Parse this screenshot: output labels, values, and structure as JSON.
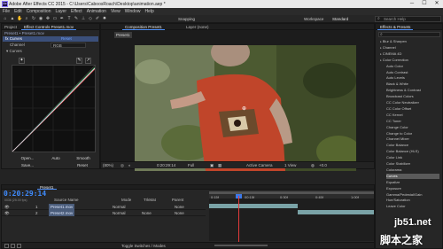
{
  "window": {
    "title": "Adobe After Effects CC 2015 - C:\\Users\\CaboosRoach\\Desktop\\animation.aep *",
    "logo": "Ae",
    "minimize": "─",
    "maximize": "☐",
    "close": "✕"
  },
  "menu": [
    "File",
    "Edit",
    "Composition",
    "Layer",
    "Effect",
    "Animation",
    "View",
    "Window",
    "Help"
  ],
  "toolbar": {
    "snapping": "Snapping",
    "workspace_label": "Workspace",
    "workspace_value": "Standard",
    "search_placeholder": "Search Help"
  },
  "effect_controls": {
    "tab_project": "Project",
    "tab_label": "Effect Controls  Preset1.mov",
    "breadcrumb": "Preset1 • Preset1.mov",
    "effect_name": "Curves",
    "reset": "Reset",
    "channel_label": "Channel",
    "channel_value": "RGB",
    "curves_label": "Curves",
    "buttons": {
      "open": "Open...",
      "auto": "Auto",
      "smooth": "Smooth",
      "save": "Save...",
      "reset": "Reset"
    }
  },
  "composition": {
    "tab_label": "Composition  Preset1",
    "layer_tab": "Layer  (none)",
    "comp_name_tab": "Preset1",
    "footer": {
      "zoom": "(80%)",
      "timecode": "0:20:29:14",
      "resolution": "Full",
      "camera": "Active Camera",
      "views": "1 View",
      "exposure": "+0.0"
    }
  },
  "effects_presets": {
    "tab_label": "Effects & Presets",
    "items": [
      {
        "label": "Blur & Sharpen",
        "sub": false,
        "sel": false
      },
      {
        "label": "Channel",
        "sub": false,
        "sel": false
      },
      {
        "label": "CINEMA 4D",
        "sub": false,
        "sel": false
      },
      {
        "label": "Color Correction",
        "sub": false,
        "sel": false
      },
      {
        "label": "Auto Color",
        "sub": true,
        "sel": false
      },
      {
        "label": "Auto Contrast",
        "sub": true,
        "sel": false
      },
      {
        "label": "Auto Levels",
        "sub": true,
        "sel": false
      },
      {
        "label": "Black & White",
        "sub": true,
        "sel": false
      },
      {
        "label": "Brightness & Contrast",
        "sub": true,
        "sel": false
      },
      {
        "label": "Broadcast Colors",
        "sub": true,
        "sel": false
      },
      {
        "label": "CC Color Neutralizer",
        "sub": true,
        "sel": false
      },
      {
        "label": "CC Color Offset",
        "sub": true,
        "sel": false
      },
      {
        "label": "CC Kernel",
        "sub": true,
        "sel": false
      },
      {
        "label": "CC Toner",
        "sub": true,
        "sel": false
      },
      {
        "label": "Change Color",
        "sub": true,
        "sel": false
      },
      {
        "label": "Change to Color",
        "sub": true,
        "sel": false
      },
      {
        "label": "Channel Mixer",
        "sub": true,
        "sel": false
      },
      {
        "label": "Color Balance",
        "sub": true,
        "sel": false
      },
      {
        "label": "Color Balance (HLS)",
        "sub": true,
        "sel": false
      },
      {
        "label": "Color Link",
        "sub": true,
        "sel": false
      },
      {
        "label": "Color Stabilizer",
        "sub": true,
        "sel": false
      },
      {
        "label": "Colorama",
        "sub": true,
        "sel": false
      },
      {
        "label": "Curves",
        "sub": true,
        "sel": true
      },
      {
        "label": "Equalize",
        "sub": true,
        "sel": false
      },
      {
        "label": "Exposure",
        "sub": true,
        "sel": false
      },
      {
        "label": "Gamma/Pedestal/Gain",
        "sub": true,
        "sel": false
      },
      {
        "label": "Hue/Saturation",
        "sub": true,
        "sel": false
      },
      {
        "label": "Leave Color",
        "sub": true,
        "sel": false
      }
    ]
  },
  "timeline": {
    "tab": "Preset1",
    "timecode": "0:20:29:14",
    "frame_info": "0036 (25.00 fps)",
    "columns": {
      "source": "Source Name",
      "mode": "Mode",
      "trkmat": "TrkMat",
      "parent": "Parent"
    },
    "layers": [
      {
        "num": "1",
        "name": "Preset1.mov",
        "mode": "Normal",
        "trkmat": "",
        "parent": "None"
      },
      {
        "num": "2",
        "name": "Preset2.mov",
        "mode": "Normal",
        "trkmat": "None",
        "parent": "None"
      }
    ],
    "ruler": [
      "0:15f",
      "00:15f",
      "0:30f",
      "0:45f",
      "1:00f",
      "0:16f"
    ],
    "footer": "Toggle Switches / Modes"
  },
  "watermark": {
    "site": "jb51.net",
    "brand": "脚本之家"
  }
}
